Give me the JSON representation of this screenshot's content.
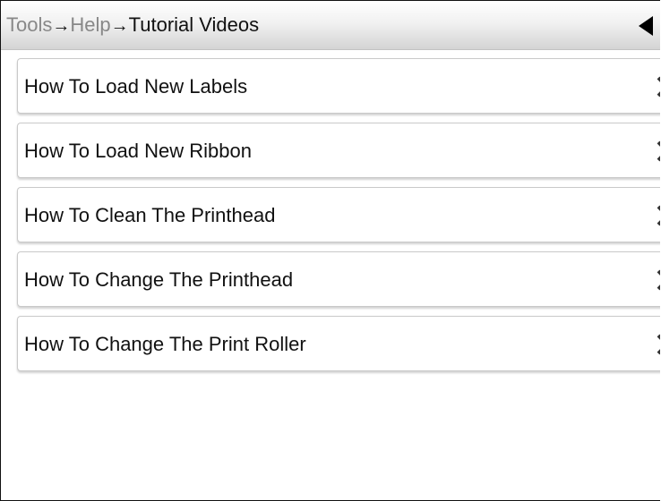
{
  "header": {
    "breadcrumb": [
      {
        "label": "Tools"
      },
      {
        "label": "Help"
      },
      {
        "label": "Tutorial Videos"
      }
    ],
    "separator": "→",
    "back_icon": "back-triangle-icon"
  },
  "menu": {
    "items": [
      {
        "label": "How To Load New Labels",
        "icon": "chevron-right-icon"
      },
      {
        "label": "How To Load New Ribbon",
        "icon": "chevron-right-icon"
      },
      {
        "label": "How To Clean The Printhead",
        "icon": "chevron-right-icon"
      },
      {
        "label": "How To Change The Printhead",
        "icon": "chevron-right-icon"
      },
      {
        "label": "How To Change The Print Roller",
        "icon": "chevron-right-icon"
      }
    ]
  },
  "colors": {
    "breadcrumb_past": "#888888",
    "breadcrumb_current": "#111111",
    "item_border": "#c9c9c9"
  }
}
